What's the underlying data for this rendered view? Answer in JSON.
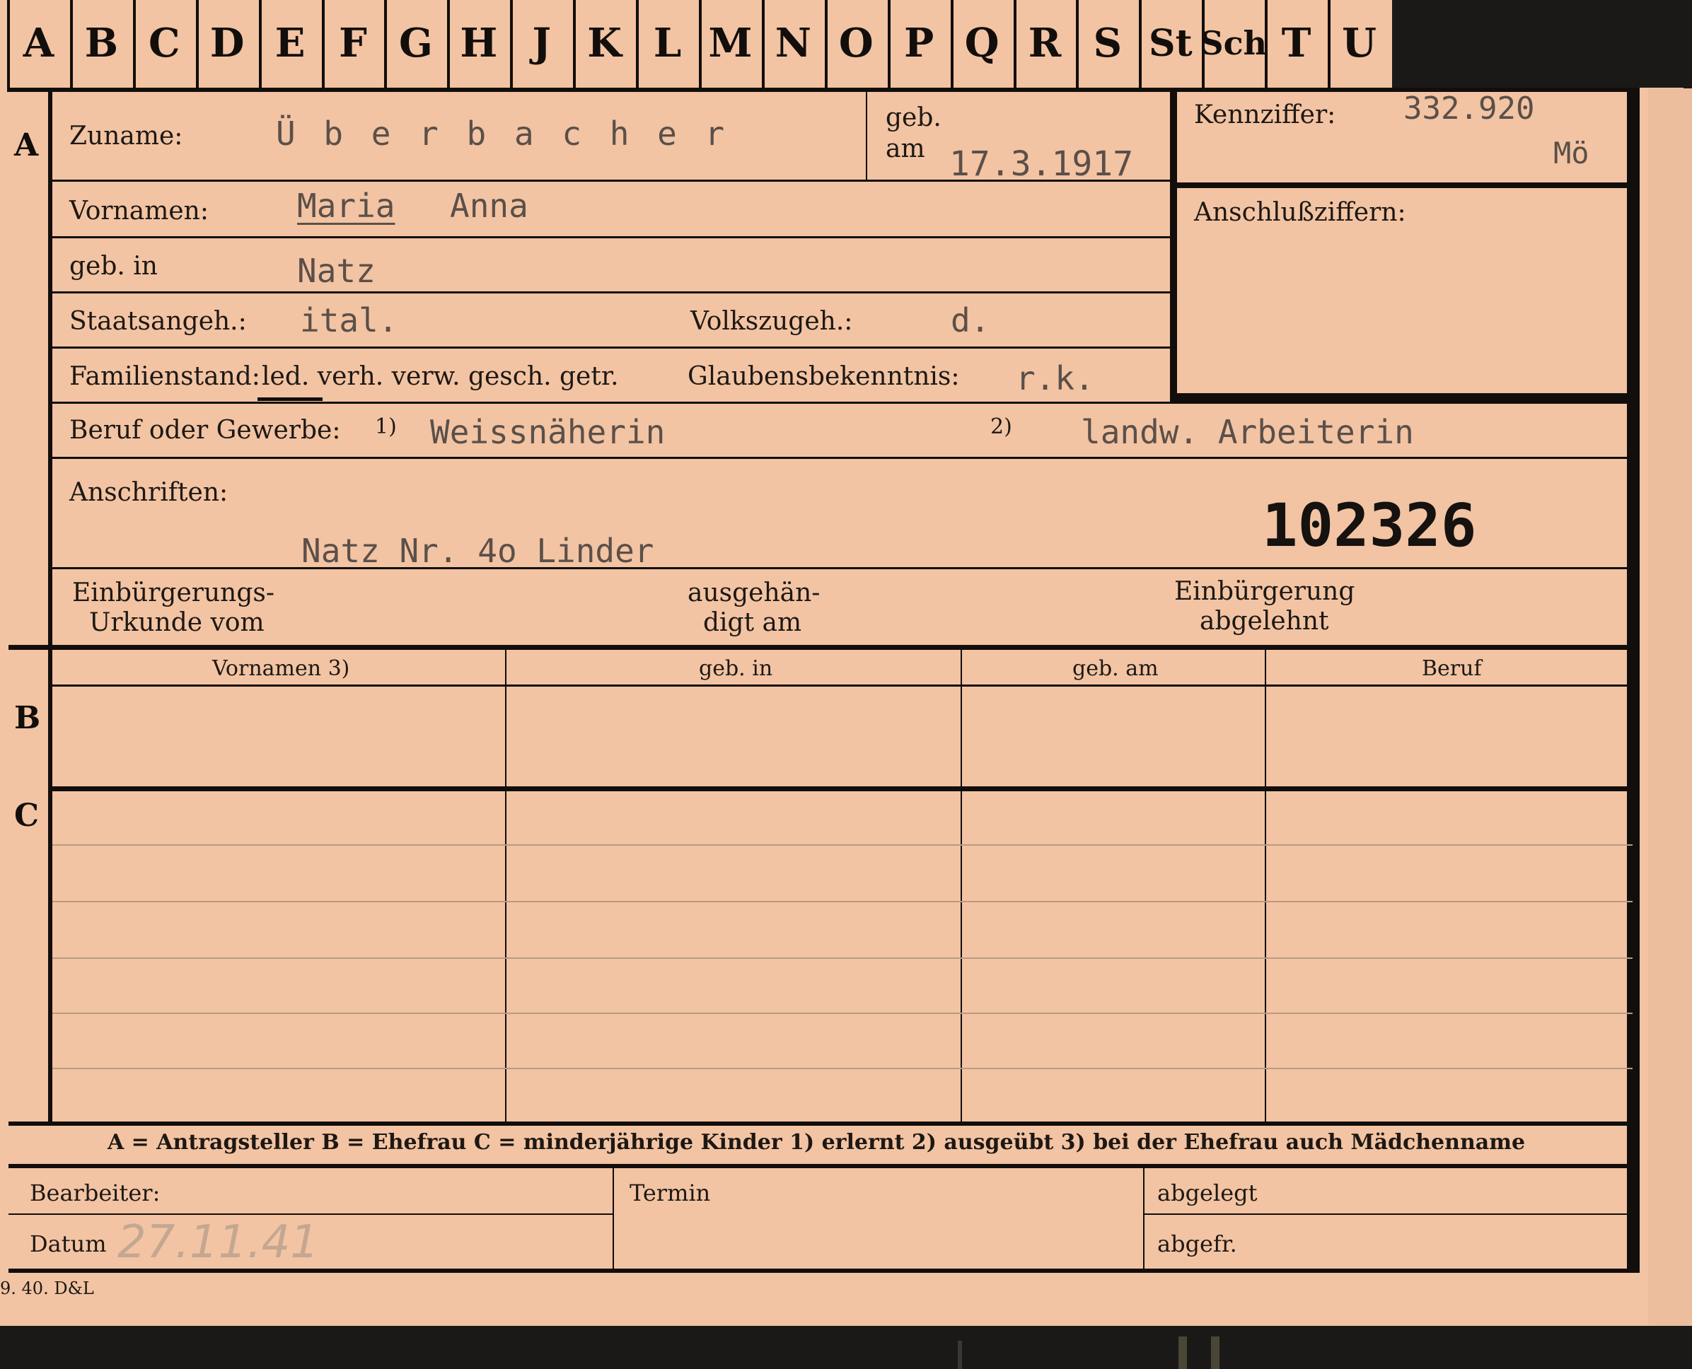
{
  "tabs": [
    "A",
    "B",
    "C",
    "D",
    "E",
    "F",
    "G",
    "H",
    "J",
    "K",
    "L",
    "M",
    "N",
    "O",
    "P",
    "Q",
    "R",
    "S",
    "St",
    "Sch",
    "T",
    "U"
  ],
  "sections": {
    "a": "A",
    "b": "B",
    "c": "C"
  },
  "labels": {
    "zuname": "Zuname:",
    "geb": "geb.",
    "am": "am",
    "kennziffer": "Kennziffer:",
    "anschlussziffern": "Anschlußziffern:",
    "vornamen": "Vornamen:",
    "geb_in": "geb. in",
    "staatsangeh": "Staatsangeh.:",
    "volkszugeh": "Volkszugeh.:",
    "familienstand": "Familienstand:",
    "familienstand_options": "led. verh. verw. gesch. getr.",
    "glaubensbekenntnis": "Glaubensbekenntnis:",
    "beruf": "Beruf oder Gewerbe:",
    "fn1": "1)",
    "fn2": "2)",
    "anschriften": "Anschriften:",
    "einbuerg_urkunde_1": "Einbürgerungs-",
    "einbuerg_urkunde_2": "Urkunde vom",
    "ausgehaen_1": "ausgehän-",
    "ausgehaen_2": "digt am",
    "einbuerg_abgelehnt_1": "Einbürgerung",
    "einbuerg_abgelehnt_2": "abgelehnt",
    "col_vornamen": "Vornamen 3)",
    "col_geb_in": "geb. in",
    "col_geb_am": "geb. am",
    "col_beruf": "Beruf",
    "legend": "A = Antragsteller   B = Ehefrau   C = minderjährige Kinder   1) erlernt   2) ausgeübt   3) bei der Ehefrau auch Mädchenname",
    "bearbeiter": "Bearbeiter:",
    "datum": "Datum",
    "termin": "Termin",
    "abgelegt": "abgelegt",
    "abgefr": "abgefr.",
    "printer": "9. 40. D&L"
  },
  "values": {
    "zuname": "Ü b e r b a c h e r",
    "geb_am": "17.3.1917",
    "kennziffer": "332.920",
    "kennziffer_suffix": "Mö",
    "vornamen_1": "Maria",
    "vornamen_2": "Anna",
    "geb_in": "Natz",
    "staatsangeh": "ital.",
    "volkszugeh": "d.",
    "glaubensbekenntnis": "r.k.",
    "beruf_erlernt": "Weissnäherin",
    "beruf_ausgeuebt": "landw. Arbeiterin",
    "anschrift": "Natz Nr. 4o Linder",
    "stempel_nummer": "102326",
    "datum": "27.11.41"
  }
}
